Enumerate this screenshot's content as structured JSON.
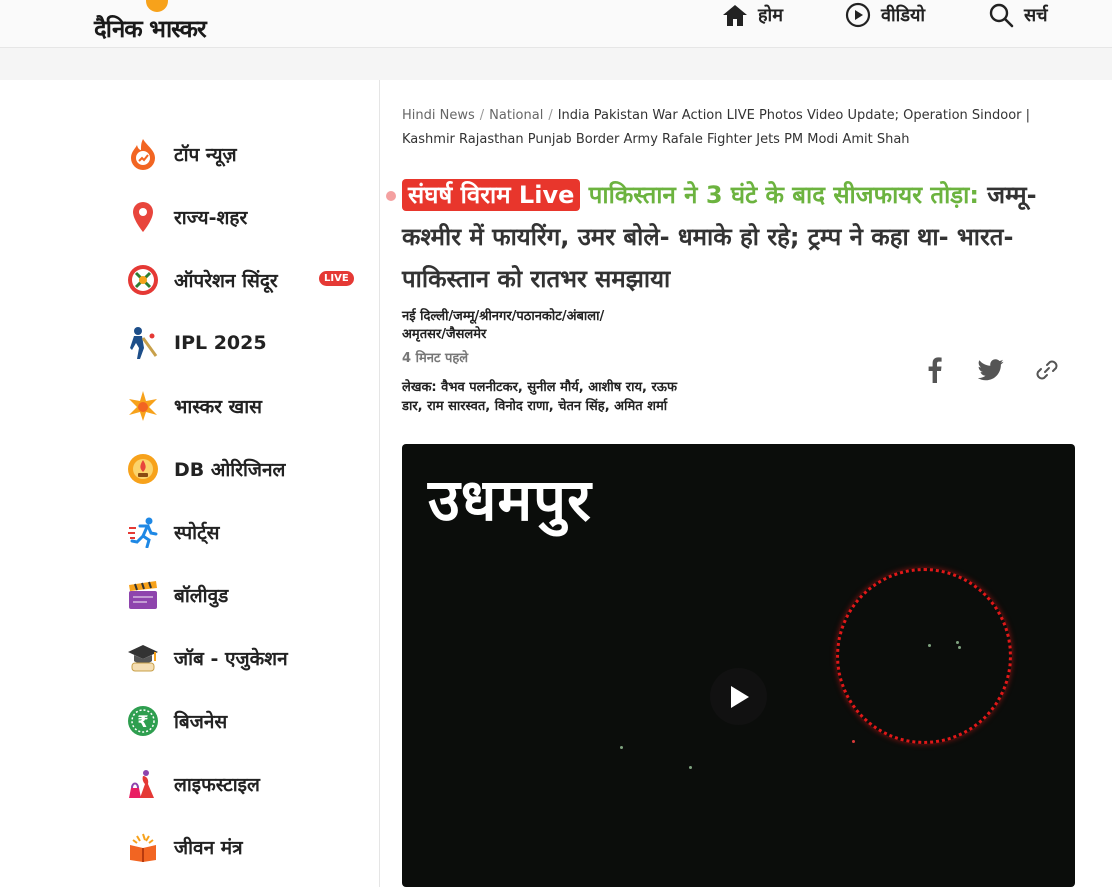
{
  "header": {
    "logo_text": "दैनिक भास्कर",
    "nav": [
      {
        "label": "होम",
        "icon": "home-icon"
      },
      {
        "label": "वीडियो",
        "icon": "play-circle-icon"
      },
      {
        "label": "सर्च",
        "icon": "search-icon"
      }
    ]
  },
  "sidebar": {
    "items": [
      {
        "label": "टॉप न्यूज़",
        "icon": "fire-trending-icon"
      },
      {
        "label": "राज्य-शहर",
        "icon": "location-pin-icon"
      },
      {
        "label": "ऑपरेशन सिंदूर",
        "icon": "operation-sindoor-icon",
        "badge": "LIVE"
      },
      {
        "label": "IPL 2025",
        "icon": "cricket-batsman-icon"
      },
      {
        "label": "भास्कर खास",
        "icon": "star-burst-icon"
      },
      {
        "label": "DB ओरिजिनल",
        "icon": "db-original-icon"
      },
      {
        "label": "स्पोर्ट्स",
        "icon": "runner-icon"
      },
      {
        "label": "बॉलीवुड",
        "icon": "clapperboard-icon"
      },
      {
        "label": "जॉब - एजुकेशन",
        "icon": "graduation-cap-icon"
      },
      {
        "label": "बिजनेस",
        "icon": "rupee-coin-icon"
      },
      {
        "label": "लाइफस्टाइल",
        "icon": "lifestyle-icon"
      },
      {
        "label": "जीवन मंत्र",
        "icon": "book-diya-icon"
      }
    ]
  },
  "article": {
    "breadcrumb": {
      "items": [
        "Hindi News",
        "National"
      ],
      "current": "India Pakistan War Action LIVE Photos Video Update; Operation Sindoor | Kashmir Rajasthan Punjab Border Army Rafale Fighter Jets PM Modi Amit Shah"
    },
    "headline": {
      "tag": "संघर्ष विराम Live",
      "highlight": "पाकिस्तान ने 3 घंटे के बाद सीजफायर तोड़ा:",
      "rest": " जम्मू-कश्मीर में फायरिंग, उमर बोले- धमाके हो रहे; ट्रम्प ने कहा था- भारत-पाकिस्तान को रातभर समझाया"
    },
    "dateline": "नई दिल्ली/जम्मू/श्रीनगर/पठानकोट/अंबाला/अमृतसर/जैसलमेर",
    "time": "4 मिनट पहले",
    "authors": "लेखक: वैभव पलनीटकर, सुनील मौर्य, आशीष राय, रऊफ डार, राम सारस्वत, विनोद राणा, चेतन सिंह, अमित शर्मा",
    "share": [
      "facebook-icon",
      "twitter-icon",
      "link-icon"
    ],
    "video": {
      "overlay_title": "उधमपुर",
      "play_icon": "play-icon"
    }
  },
  "colors": {
    "live_red": "#e8362c",
    "headline_green": "#6cb33f",
    "logo_orange": "#f7a21b"
  }
}
